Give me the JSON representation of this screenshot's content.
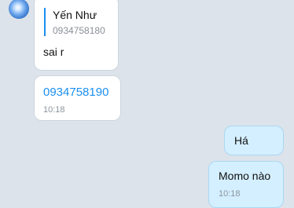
{
  "messages": {
    "reply": {
      "quoted_name": "Yến Như",
      "quoted_text": "0934758180",
      "text": "sai r"
    },
    "phone": {
      "link": "0934758190",
      "time": "10:18"
    },
    "out1": {
      "text": "Há"
    },
    "out2": {
      "text": "Momo nào",
      "time": "10:18"
    }
  },
  "colors": {
    "background": "#dde3ea",
    "incoming_bubble": "#ffffff",
    "outgoing_bubble": "#d4efff",
    "link": "#1a8ff0",
    "timestamp": "#8d959e"
  },
  "icons": {
    "avatar": "contact-avatar"
  }
}
